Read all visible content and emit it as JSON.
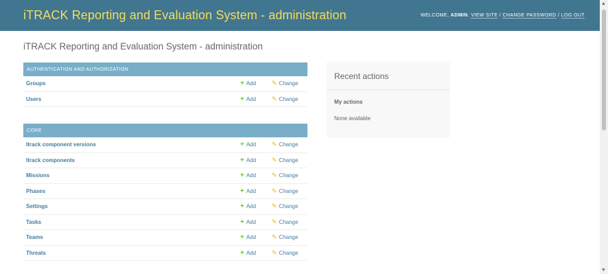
{
  "header": {
    "site_title": "iTRACK Reporting and Evaluation System - administration",
    "welcome": "WELCOME,",
    "user": "ADMIN",
    "view_site": "VIEW SITE",
    "change_password": "CHANGE PASSWORD",
    "log_out": "LOG OUT",
    "separator": "/"
  },
  "content_title": "iTRACK Reporting and Evaluation System - administration",
  "modules": [
    {
      "caption": "AUTHENTICATION AND AUTHORIZATION",
      "rows": [
        {
          "name": "Groups",
          "add": "Add",
          "change": "Change"
        },
        {
          "name": "Users",
          "add": "Add",
          "change": "Change"
        }
      ]
    },
    {
      "caption": "CORE",
      "rows": [
        {
          "name": "Itrack component versions",
          "add": "Add",
          "change": "Change"
        },
        {
          "name": "Itrack components",
          "add": "Add",
          "change": "Change"
        },
        {
          "name": "Missions",
          "add": "Add",
          "change": "Change"
        },
        {
          "name": "Phases",
          "add": "Add",
          "change": "Change"
        },
        {
          "name": "Settings",
          "add": "Add",
          "change": "Change"
        },
        {
          "name": "Tasks",
          "add": "Add",
          "change": "Change"
        },
        {
          "name": "Teams",
          "add": "Add",
          "change": "Change"
        },
        {
          "name": "Threats",
          "add": "Add",
          "change": "Change"
        }
      ]
    }
  ],
  "recent_actions": {
    "title": "Recent actions",
    "my_actions": "My actions",
    "none": "None available"
  },
  "icons": {
    "add": "plus-icon",
    "change": "pencil-icon"
  },
  "colors": {
    "header_bg": "#417690",
    "branding": "#f5dd5d",
    "module_caption_bg": "#79aec8",
    "link": "#447e9b",
    "add_icon": "#70bf2b",
    "change_icon": "#efb80b"
  }
}
